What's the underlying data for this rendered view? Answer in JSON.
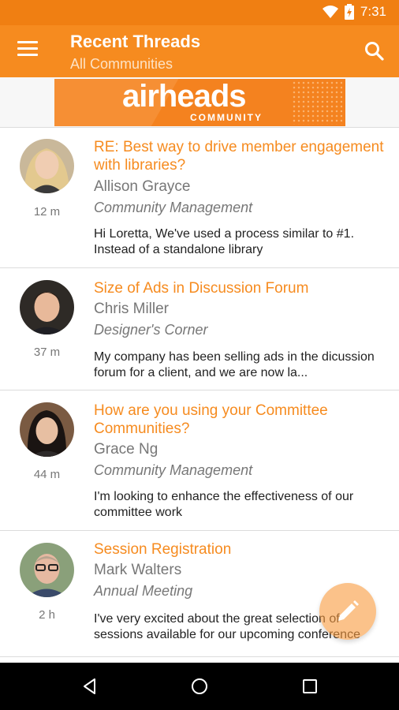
{
  "status_bar": {
    "time": "7:31",
    "icons": [
      "wifi-icon",
      "battery-icon"
    ]
  },
  "app_bar": {
    "title": "Recent Threads",
    "subtitle": "All Communities",
    "menu_icon": "menu-icon",
    "search_icon": "search-icon"
  },
  "banner": {
    "logo_text": "airheads",
    "logo_subtext": "COMMUNITY"
  },
  "colors": {
    "accent": "#f68b1f",
    "status_bar": "#f07f12",
    "secondary_text": "#777777",
    "fab": "#f99a3d"
  },
  "threads": [
    {
      "title": "RE: Best way to drive member engagement with libraries?",
      "author": "Allison Grayce",
      "community": "Community Management",
      "snippet": "Hi Loretta, We've used a process similar to #1. Instead of a standalone library",
      "age": "12 m"
    },
    {
      "title": "Size of Ads in Discussion Forum",
      "author": "Chris Miller",
      "community": "Designer's Corner",
      "snippet": "My company has been selling ads in the dicussion forum for a client, and we are now la...",
      "age": "37 m"
    },
    {
      "title": "How are you using your Committee Communities?",
      "author": "Grace Ng",
      "community": "Community Management",
      "snippet": "I'm looking to enhance the effectiveness of our committee work",
      "age": "44 m"
    },
    {
      "title": "Session Registration",
      "author": "Mark Walters",
      "community": "Annual Meeting",
      "snippet": "I've very excited about the great selection of sessions available for our upcoming conference",
      "age": "2 h"
    }
  ],
  "fab": {
    "icon": "edit-pencil-icon"
  },
  "nav_bar": {
    "icons": [
      "back-icon",
      "home-icon",
      "recents-icon"
    ]
  }
}
